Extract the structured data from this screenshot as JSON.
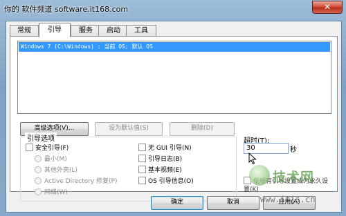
{
  "window": {
    "title": "你的 软件频道 software.it168.com",
    "close_glyph": "✕"
  },
  "tabs": [
    {
      "label": "常规",
      "active": false
    },
    {
      "label": "引导",
      "active": true
    },
    {
      "label": "服务",
      "active": false
    },
    {
      "label": "启动",
      "active": false
    },
    {
      "label": "工具",
      "active": false
    }
  ],
  "boot": {
    "os_entries": [
      "Windows 7 (C:\\Windows) : 当前 OS; 默认 OS"
    ],
    "buttons": {
      "advanced": "高级选项(V)...",
      "set_default": "设为默认值(S)",
      "delete": "删除(D)"
    },
    "group_title": "引导选项",
    "safe_boot": "安全引导(F)",
    "radios": [
      "最小(M)",
      "其他外壳(L)",
      "Active Directory 修复(P)",
      "网络(W)"
    ],
    "options": [
      "无 GUI 引导(N)",
      "引导日志(B)",
      "基本视频(E)",
      "OS 引导信息(O)"
    ],
    "timeout_label": "超时(T):",
    "timeout_value": "30",
    "timeout_unit": "秒",
    "permanent_label": "使所有引导设置成为永久设置(K)"
  },
  "dialog_buttons": {
    "ok": "确定",
    "cancel": "取消",
    "apply": "应用(A)"
  },
  "watermark": {
    "title": "技术网",
    "url": "www.itjs.cn"
  }
}
